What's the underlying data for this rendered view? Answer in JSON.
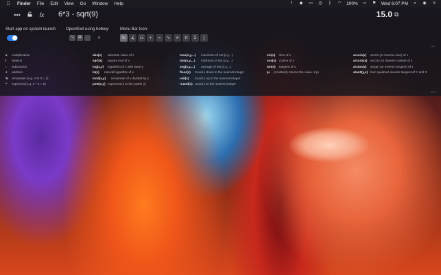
{
  "menubar": {
    "apple": "",
    "items": [
      "Finder",
      "File",
      "Edit",
      "View",
      "Go",
      "Window",
      "Help"
    ],
    "battery": "100%",
    "clock": "Wed 6:07 PM"
  },
  "toolbar": {
    "more_icon": "•••",
    "lock_icon": "lock",
    "fx_label": "fx",
    "expression": "6*3 - sqrt(9)",
    "result": "15.0"
  },
  "settings": {
    "launch_label": "Start app on system launch:",
    "launch_enabled": true,
    "hotkey_label": "Open/Exit using hotkey:",
    "hotkey_keys": [
      "⌥",
      "⌘",
      "",
      "✕"
    ],
    "menubar_icon_label": "Menu Bar Icon:",
    "menubar_icons": [
      "fx",
      "∡",
      "☷",
      "+",
      "=",
      "∿",
      "≠",
      "π",
      "Σ",
      "∫"
    ]
  },
  "reference": {
    "operators": [
      {
        "sym": "x",
        "desc": "multiplication"
      },
      {
        "sym": "/",
        "desc": "division"
      },
      {
        "sym": "-",
        "desc": "subtraction"
      },
      {
        "sym": "+",
        "desc": "addition"
      },
      {
        "sym": "%",
        "desc": "remainder (e.g. 4 % 3 = 1)"
      },
      {
        "sym": "^",
        "desc": "exponent (e.g. 3 ^ 2 = 9)"
      }
    ],
    "basic": [
      {
        "sym": "abs(x)",
        "desc": "absolute value of x"
      },
      {
        "sym": "sqrt(x)",
        "desc": "square root of x"
      },
      {
        "sym": "log(x,y)",
        "desc": "logarithm of x with base y"
      },
      {
        "sym": "ln(x)",
        "desc": "natural logarithm of x"
      },
      {
        "sym": "mod(x,y)",
        "desc": "remainder of x divided by y"
      },
      {
        "sym": "pow(x,y)",
        "desc": "exponent (x to the power y)"
      }
    ],
    "sets": [
      {
        "sym": "max(x,y,...)",
        "desc": "maximum of set (x,y,...)"
      },
      {
        "sym": "min(x,y,...)",
        "desc": "minimum of set (x,y,...)"
      },
      {
        "sym": "avg(x,y,...)",
        "desc": "average of set (x,y,...)"
      },
      {
        "sym": "floor(x)",
        "desc": "round x down to the nearest integer"
      },
      {
        "sym": "ceil(x)",
        "desc": "round x up to the nearest integer"
      },
      {
        "sym": "round(x)",
        "desc": "round x to the nearest integer"
      }
    ],
    "trig": [
      {
        "sym": "sin(x)",
        "desc": "sine of x"
      },
      {
        "sym": "cos(x)",
        "desc": "cosine of x"
      },
      {
        "sym": "tan(x)",
        "desc": "tangent of x"
      },
      {
        "sym": "pi",
        "desc": "(constant) returns the value of pi"
      }
    ],
    "inverse": [
      {
        "sym": "arcsin(x)",
        "desc": "arcsin (or inverse sine) of x"
      },
      {
        "sym": "arccos(x)",
        "desc": "arccos (or inverse cosine) of x"
      },
      {
        "sym": "arctan(x)",
        "desc": "arctan (or inverse tangent) of x"
      },
      {
        "sym": "atan2(y,x)",
        "desc": "four quadrant inverse tangent of Y and X"
      }
    ]
  },
  "colors": {
    "accent": "#2f7fe8",
    "panel": "#16161c"
  }
}
